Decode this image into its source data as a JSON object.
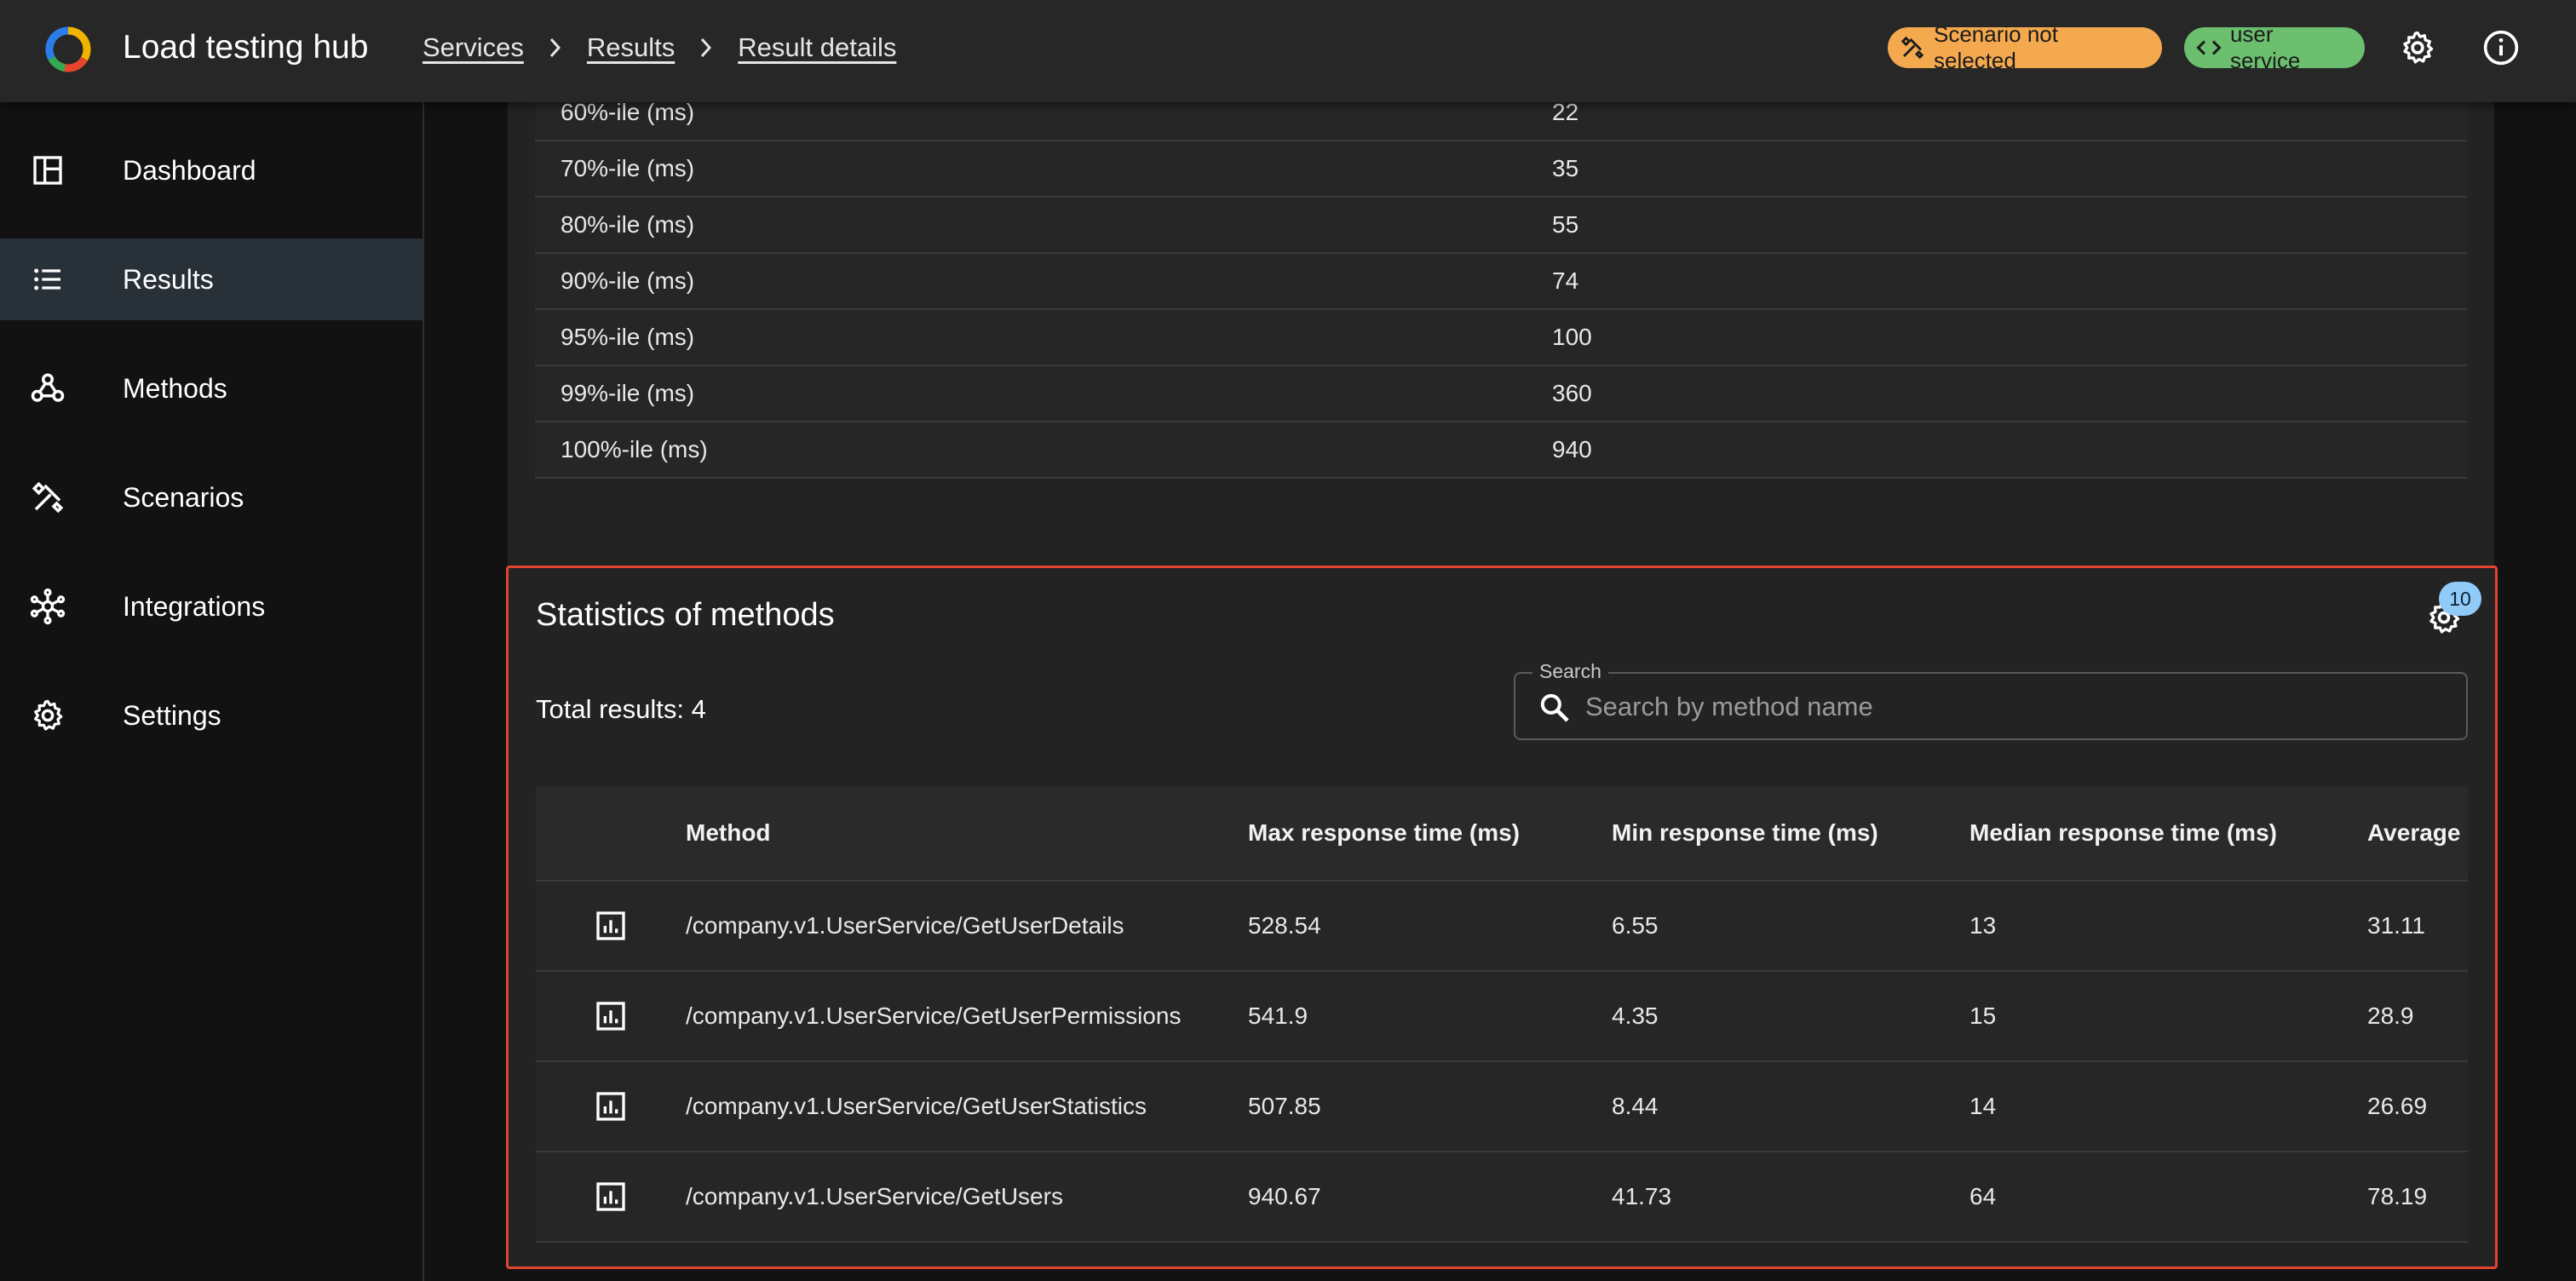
{
  "header": {
    "title": "Load testing hub",
    "breadcrumbs": [
      "Services",
      "Results",
      "Result details"
    ],
    "scenario_chip": "Scenario not selected",
    "service_chip": "user service",
    "colors": {
      "warning_chip": "#f5a94e",
      "service_chip": "#6bbf6e"
    }
  },
  "sidebar": {
    "items": [
      {
        "label": "Dashboard",
        "icon": "dashboard-icon",
        "active": false
      },
      {
        "label": "Results",
        "icon": "list-icon",
        "active": true
      },
      {
        "label": "Methods",
        "icon": "webhook-icon",
        "active": false
      },
      {
        "label": "Scenarios",
        "icon": "tools-icon",
        "active": false
      },
      {
        "label": "Integrations",
        "icon": "hub-icon",
        "active": false
      },
      {
        "label": "Settings",
        "icon": "gear-icon",
        "active": false
      }
    ]
  },
  "percentiles": [
    {
      "label": "60%-ile (ms)",
      "value": "22"
    },
    {
      "label": "70%-ile (ms)",
      "value": "35"
    },
    {
      "label": "80%-ile (ms)",
      "value": "55"
    },
    {
      "label": "90%-ile (ms)",
      "value": "74"
    },
    {
      "label": "95%-ile (ms)",
      "value": "100"
    },
    {
      "label": "99%-ile (ms)",
      "value": "360"
    },
    {
      "label": "100%-ile (ms)",
      "value": "940"
    }
  ],
  "stats": {
    "title": "Statistics of methods",
    "badge": "10",
    "total": "Total results: 4",
    "search": {
      "label": "Search",
      "placeholder": "Search by method name",
      "value": ""
    },
    "columns": [
      "Method",
      "Max response time (ms)",
      "Min response time (ms)",
      "Median response time (ms)",
      "Average r"
    ],
    "rows": [
      {
        "method": "/company.v1.UserService/GetUserDetails",
        "max": "528.54",
        "min": "6.55",
        "median": "13",
        "avg": "31.11"
      },
      {
        "method": "/company.v1.UserService/GetUserPermissions",
        "max": "541.9",
        "min": "4.35",
        "median": "15",
        "avg": "28.9"
      },
      {
        "method": "/company.v1.UserService/GetUserStatistics",
        "max": "507.85",
        "min": "8.44",
        "median": "14",
        "avg": "26.69"
      },
      {
        "method": "/company.v1.UserService/GetUsers",
        "max": "940.67",
        "min": "41.73",
        "median": "64",
        "avg": "78.19"
      }
    ]
  }
}
